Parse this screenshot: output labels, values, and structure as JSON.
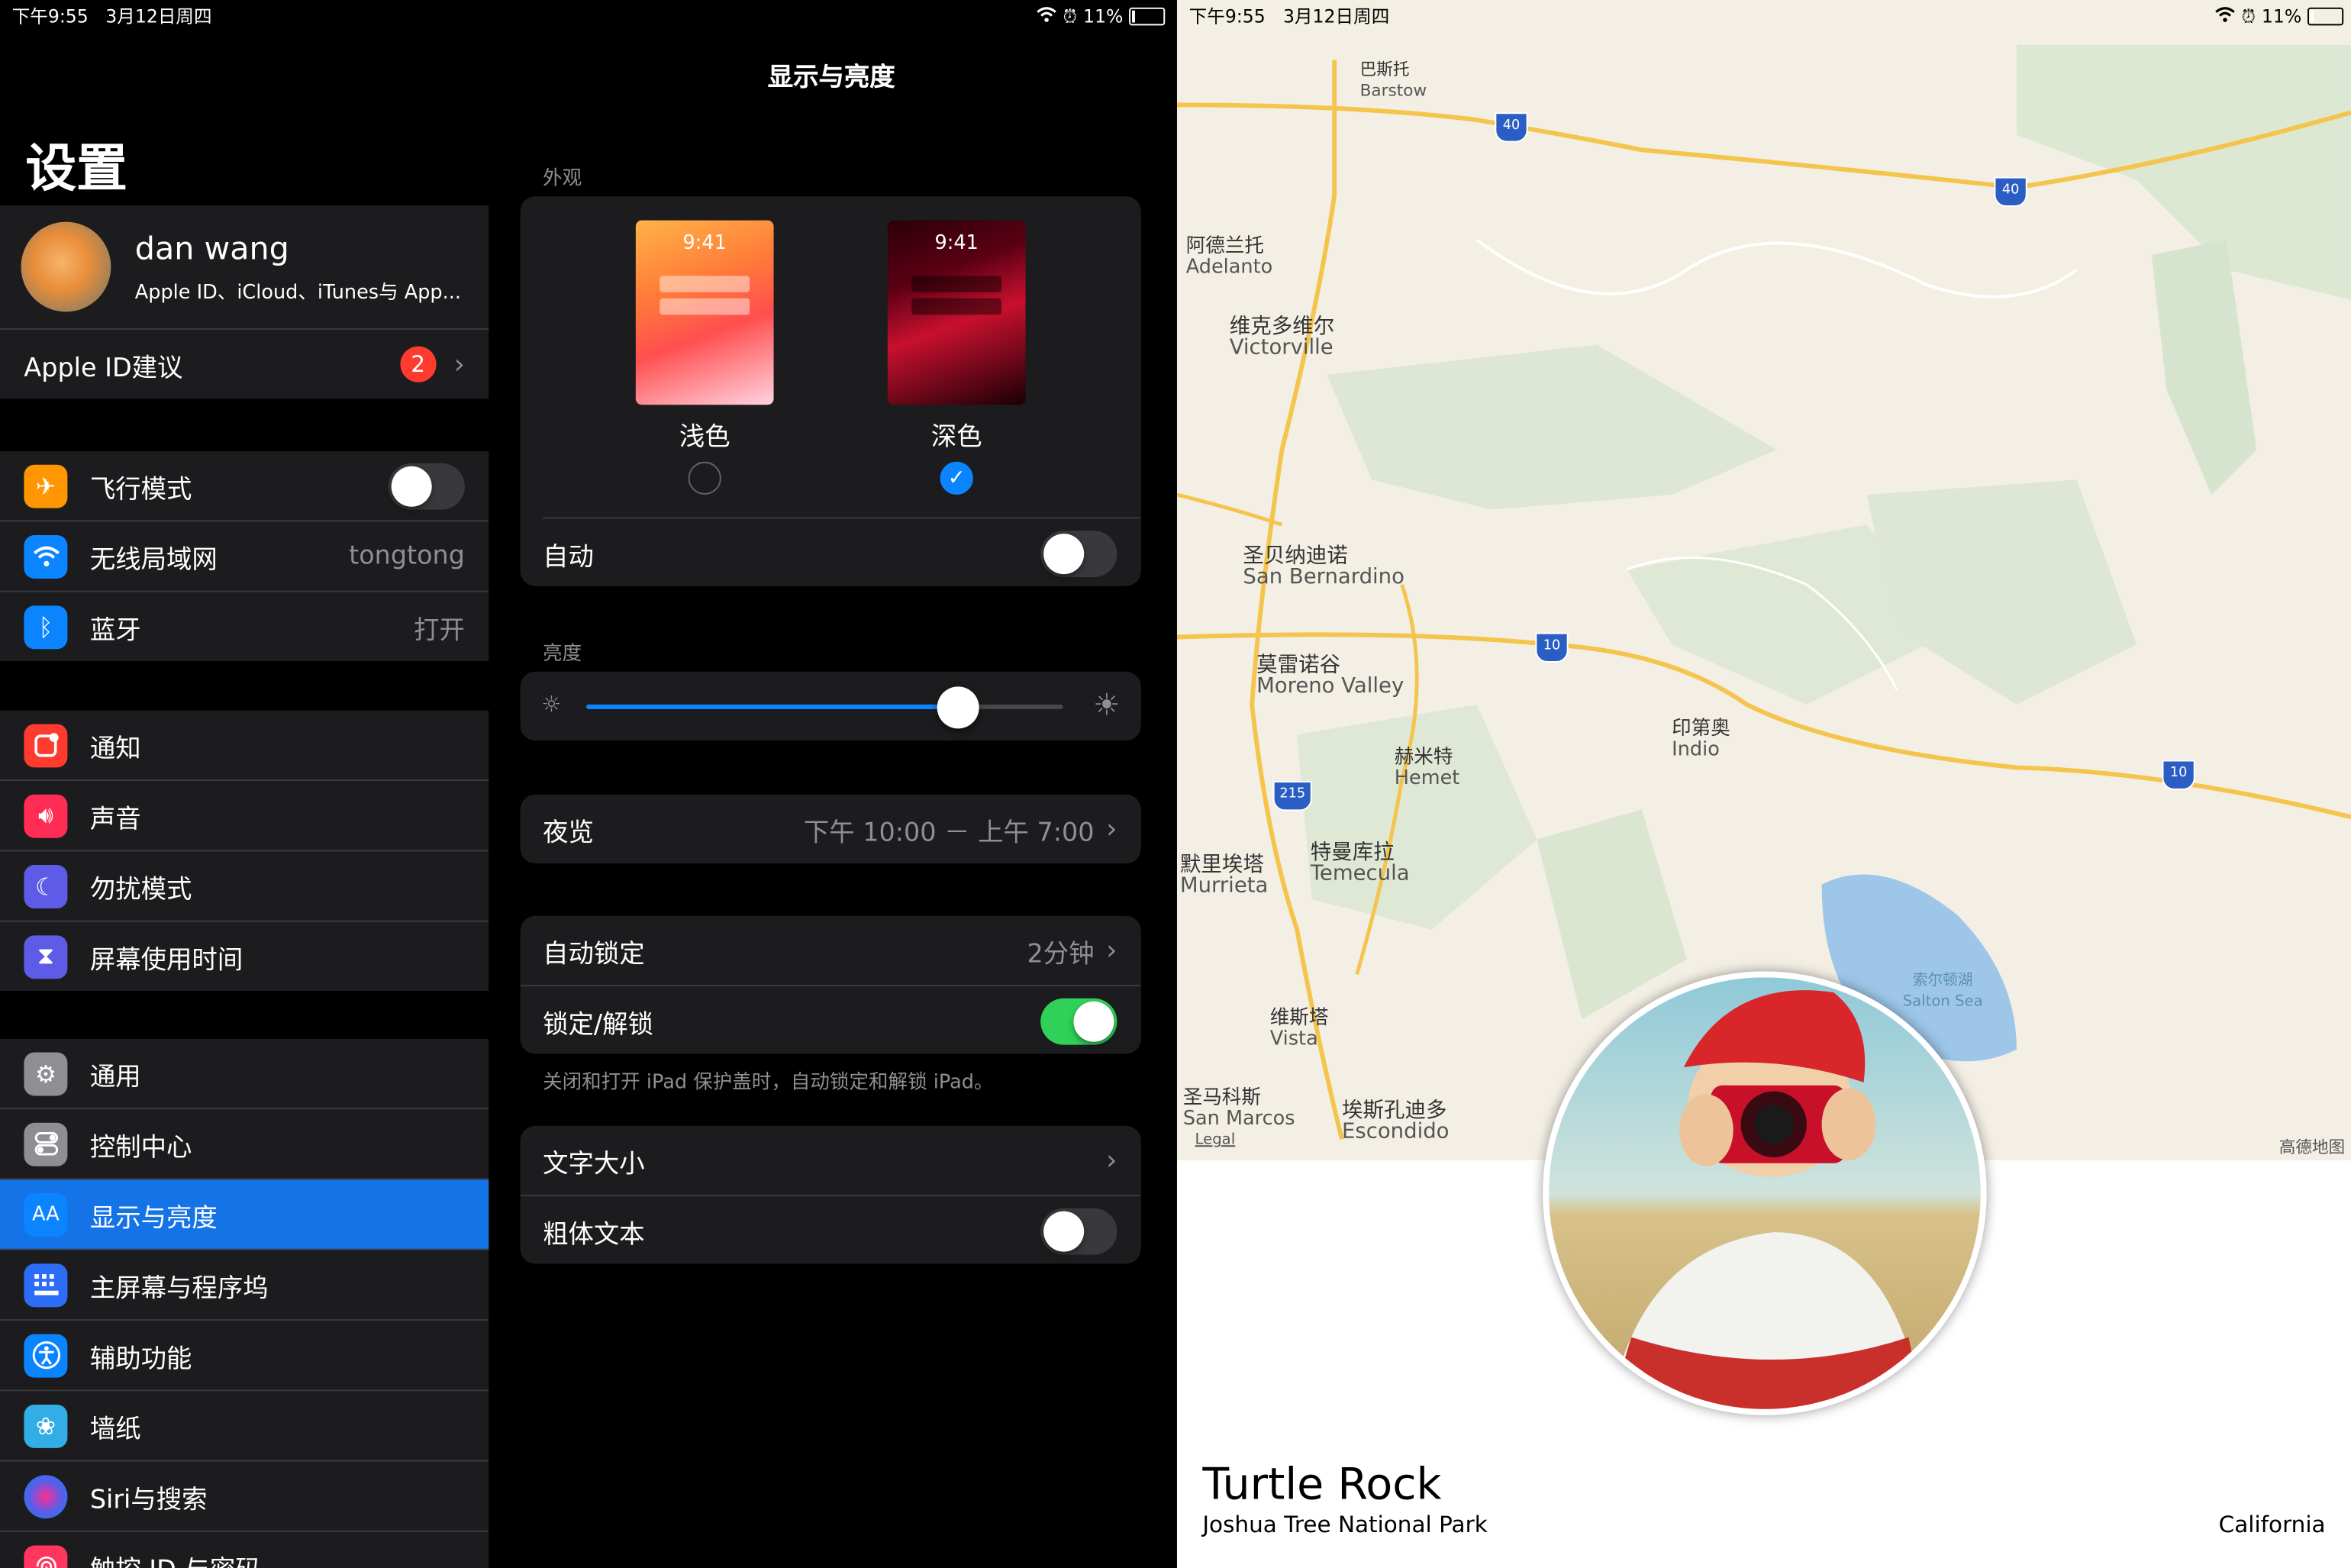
{
  "status": {
    "time": "下午9:55",
    "date": "3月12日周四",
    "battery": "11%"
  },
  "settings": {
    "title": "设置",
    "profile": {
      "name": "dan wang",
      "subtitle": "Apple ID、iCloud、iTunes与 App..."
    },
    "apple_id_suggest": {
      "label": "Apple ID建议",
      "badge": "2"
    },
    "connectivity": [
      {
        "label": "飞行模式",
        "icon": "airplane-icon",
        "color": "#ff9500",
        "toggle": false
      },
      {
        "label": "无线局域网",
        "icon": "wifi-icon",
        "color": "#0a84ff",
        "value": "tongtong"
      },
      {
        "label": "蓝牙",
        "icon": "bluetooth-icon",
        "color": "#0a84ff",
        "value": "打开"
      }
    ],
    "notifications": [
      {
        "label": "通知",
        "icon": "notification-icon",
        "color": "#ff3b30"
      },
      {
        "label": "声音",
        "icon": "sound-icon",
        "color": "#ff2d55"
      },
      {
        "label": "勿扰模式",
        "icon": "moon-icon",
        "color": "#5e5ce6"
      },
      {
        "label": "屏幕使用时间",
        "icon": "hourglass-icon",
        "color": "#5e5ce6"
      }
    ],
    "general": [
      {
        "label": "通用",
        "icon": "gear-icon",
        "color": "#8e8e93"
      },
      {
        "label": "控制中心",
        "icon": "control-center-icon",
        "color": "#8e8e93"
      },
      {
        "label": "显示与亮度",
        "icon": "display-icon",
        "color": "#0a84ff",
        "selected": true
      },
      {
        "label": "主屏幕与程序坞",
        "icon": "home-screen-icon",
        "color": "#2c6cf6"
      },
      {
        "label": "辅助功能",
        "icon": "accessibility-icon",
        "color": "#0a84ff"
      },
      {
        "label": "墙纸",
        "icon": "wallpaper-icon",
        "color": "#32ade6"
      },
      {
        "label": "Siri与搜索",
        "icon": "siri-icon",
        "color": "#1c1c1e"
      },
      {
        "label": "触控 ID 与密码",
        "icon": "fingerprint-icon",
        "color": "#ff375f"
      }
    ]
  },
  "display": {
    "nav_title": "显示与亮度",
    "appearance_header": "外观",
    "light_label": "浅色",
    "dark_label": "深色",
    "thumb_time": "9:41",
    "selected_appearance": "dark",
    "auto_label": "自动",
    "auto_on": false,
    "brightness_header": "亮度",
    "brightness_level": 0.78,
    "night_shift_label": "夜览",
    "night_shift_value": "下午 10:00 － 上午 7:00",
    "auto_lock_label": "自动锁定",
    "auto_lock_value": "2分钟",
    "lock_unlock_label": "锁定/解锁",
    "lock_unlock_on": true,
    "lock_footer": "关闭和打开 iPad 保护盖时，自动锁定和解锁 iPad。",
    "text_size_label": "文字大小",
    "bold_text_label": "粗体文本",
    "bold_on": false
  },
  "landmark": {
    "name": "Turtle Rock",
    "park": "Joshua Tree National Park",
    "state": "California",
    "map_attribution": "高德地图",
    "map_labels": [
      {
        "zh": "巴斯托",
        "en": "Barstow"
      },
      {
        "zh": "阿德兰托",
        "en": "Adelanto"
      },
      {
        "zh": "维克多维尔",
        "en": "Victorville"
      },
      {
        "zh": "圣贝纳迪诺",
        "en": "San Bernardino"
      },
      {
        "zh": "莫雷诺谷",
        "en": "Moreno Valley"
      },
      {
        "zh": "赫米特",
        "en": "Hemet"
      },
      {
        "zh": "印第奥",
        "en": "Indio"
      },
      {
        "zh": "默里埃塔",
        "en": "Murrieta"
      },
      {
        "zh": "特曼库拉",
        "en": "Temecula"
      },
      {
        "zh": "维斯塔",
        "en": "Vista"
      },
      {
        "zh": "圣马科斯",
        "en": "San Marcos"
      },
      {
        "zh": "埃斯孔迪多",
        "en": "Escondido"
      },
      {
        "zh": "索尔顿湖",
        "en": "Salton Sea"
      }
    ],
    "highway_shields": [
      "40",
      "40",
      "10",
      "10",
      "215"
    ],
    "legal": "Legal"
  }
}
